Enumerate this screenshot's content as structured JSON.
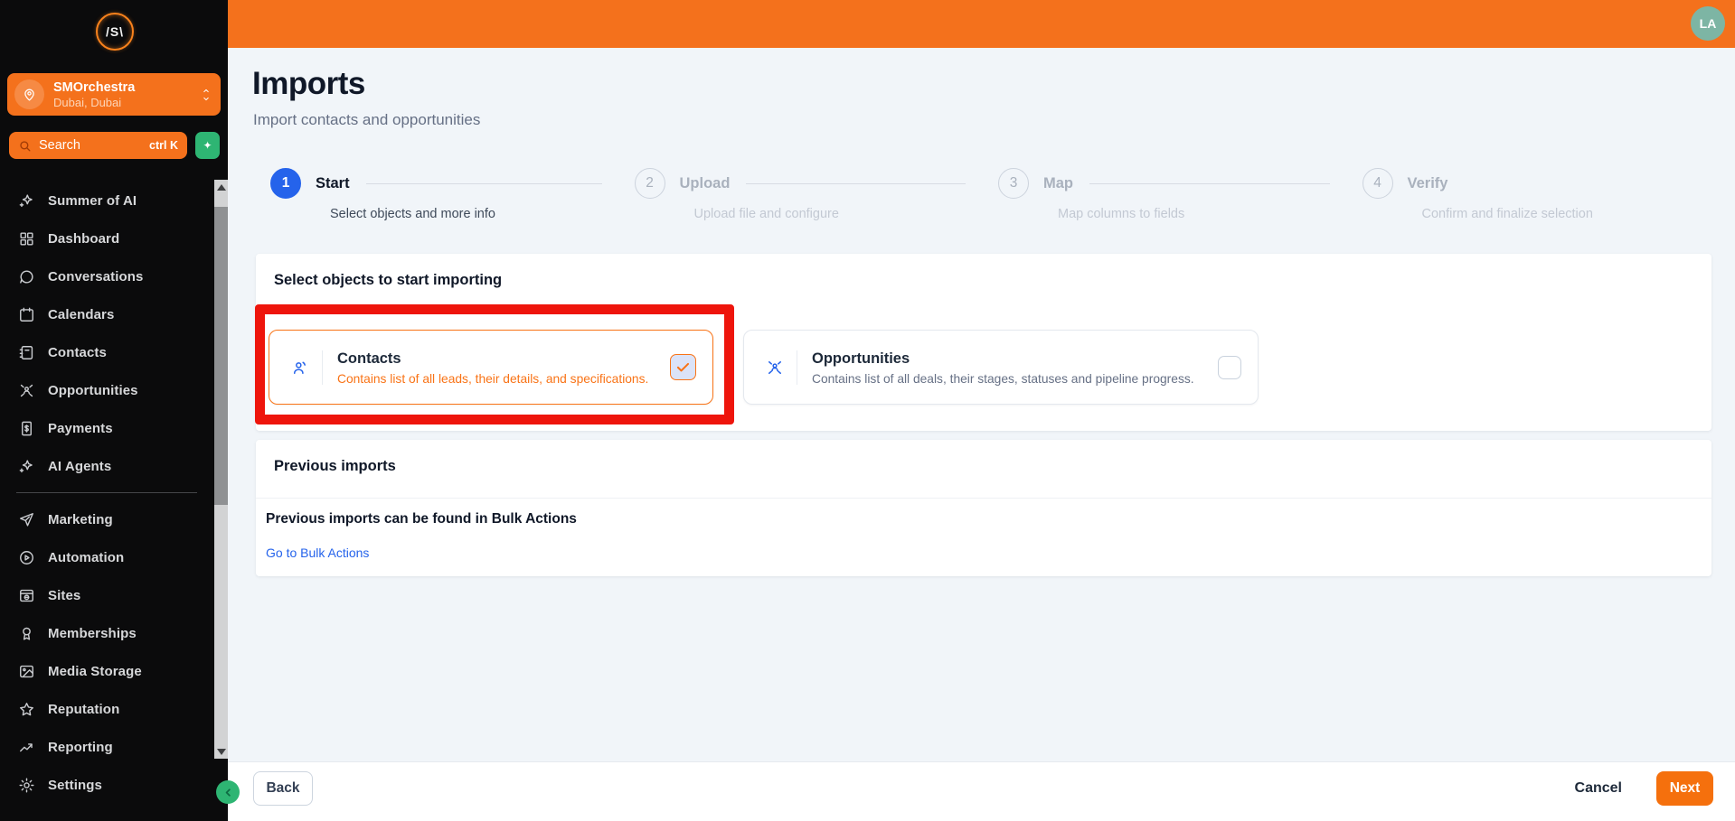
{
  "sidebar": {
    "logo_text": "/S\\",
    "account": {
      "name": "SMOrchestra",
      "location": "Dubai, Dubai"
    },
    "search": {
      "placeholder": "Search",
      "shortcut": "ctrl K"
    },
    "items": [
      {
        "label": "Summer of AI",
        "icon": "sparkle-icon"
      },
      {
        "label": "Dashboard",
        "icon": "grid-icon"
      },
      {
        "label": "Conversations",
        "icon": "chat-icon"
      },
      {
        "label": "Calendars",
        "icon": "calendar-icon"
      },
      {
        "label": "Contacts",
        "icon": "contacts-book-icon"
      },
      {
        "label": "Opportunities",
        "icon": "opportunities-icon"
      },
      {
        "label": "Payments",
        "icon": "payments-icon"
      },
      {
        "label": "AI Agents",
        "icon": "sparkle-icon",
        "divider_after": true
      },
      {
        "label": "Marketing",
        "icon": "send-icon"
      },
      {
        "label": "Automation",
        "icon": "play-circle-icon"
      },
      {
        "label": "Sites",
        "icon": "browser-icon"
      },
      {
        "label": "Memberships",
        "icon": "award-icon"
      },
      {
        "label": "Media Storage",
        "icon": "image-icon"
      },
      {
        "label": "Reputation",
        "icon": "star-icon"
      },
      {
        "label": "Reporting",
        "icon": "trend-icon"
      },
      {
        "label": "Settings",
        "icon": "gear-icon"
      }
    ]
  },
  "topbar": {
    "avatar_initials": "LA"
  },
  "header": {
    "title": "Imports",
    "subtitle": "Import contacts and opportunities"
  },
  "stepper": [
    {
      "number": "1",
      "label": "Start",
      "description": "Select objects and more info",
      "active": true
    },
    {
      "number": "2",
      "label": "Upload",
      "description": "Upload file and configure",
      "active": false
    },
    {
      "number": "3",
      "label": "Map",
      "description": "Map columns to fields",
      "active": false
    },
    {
      "number": "4",
      "label": "Verify",
      "description": "Confirm and finalize selection",
      "active": false
    }
  ],
  "select_objects": {
    "heading": "Select objects to start importing",
    "options": [
      {
        "title": "Contacts",
        "description": "Contains list of all leads, their details, and specifications.",
        "icon": "user-voice-icon",
        "checked": true,
        "highlighted": true
      },
      {
        "title": "Opportunities",
        "description": "Contains list of all deals, their stages, statuses and pipeline progress.",
        "icon": "opportunities-icon",
        "checked": false,
        "highlighted": false
      }
    ]
  },
  "previous_imports": {
    "heading": "Previous imports",
    "message": "Previous imports can be found in Bulk Actions",
    "link": "Go to Bulk Actions"
  },
  "footer": {
    "back": "Back",
    "cancel": "Cancel",
    "next": "Next"
  },
  "colors": {
    "accent_orange": "#f4711c",
    "selected_orange": "#f97316",
    "step_blue": "#2563eb",
    "link_blue": "#2563eb",
    "annotation_red": "#ee150c",
    "avatar_teal": "#7db5a4",
    "green": "#2eb573",
    "sidebar_bg": "#0b0b0c",
    "page_bg": "#f1f5f9"
  }
}
